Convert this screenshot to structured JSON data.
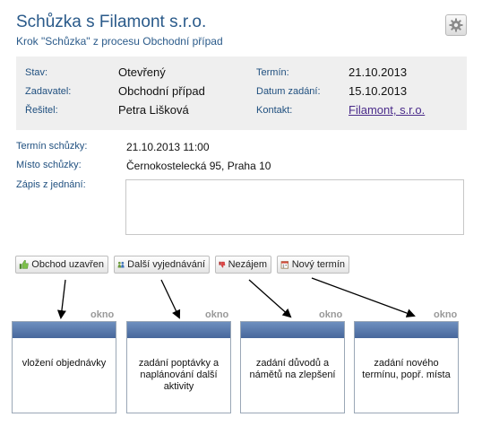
{
  "header": {
    "title": "Schůzka s Filamont s.r.o.",
    "subtitle": "Krok \"Schůzka\" z procesu Obchodní případ",
    "settings_icon": "gear-icon"
  },
  "info": {
    "stav_label": "Stav:",
    "stav_value": "Otevřený",
    "zadavatel_label": "Zadavatel:",
    "zadavatel_value": "Obchodní případ",
    "resitel_label": "Řešitel:",
    "resitel_value": "Petra Lišková",
    "termin_label": "Termín:",
    "termin_value": "21.10.2013",
    "datum_label": "Datum zadání:",
    "datum_value": "15.10.2013",
    "kontakt_label": "Kontakt:",
    "kontakt_value": "Filamont, s.r.o."
  },
  "form": {
    "termin_schuzky_label": "Termín schůzky:",
    "termin_schuzky_value": "21.10.2013 11:00",
    "misto_label": "Místo schůzky:",
    "misto_value": "Černokostelecká 95, Praha 10",
    "zapis_label": "Zápis z jednání:",
    "zapis_value": ""
  },
  "actions": [
    {
      "label": "Obchod uzavřen",
      "icon": "thumbs-up-icon"
    },
    {
      "label": "Další vyjednávání",
      "icon": "handshake-icon"
    },
    {
      "label": "Nezájem",
      "icon": "thumbs-down-icon"
    },
    {
      "label": "Nový termín",
      "icon": "calendar-icon"
    }
  ],
  "windows": [
    {
      "tag": "okno",
      "text": "vložení objednávky"
    },
    {
      "tag": "okno",
      "text": "zadání poptávky a naplánování další aktivity"
    },
    {
      "tag": "okno",
      "text": "zadání důvodů a námětů na zlepšení"
    },
    {
      "tag": "okno",
      "text": "zadání nového termínu, popř. místa"
    }
  ],
  "colors": {
    "title": "#2a5a8a",
    "label": "#1f4f7f",
    "info_bg": "#efefef",
    "window_bar": "#47679b",
    "link": "#4a2b8a"
  }
}
